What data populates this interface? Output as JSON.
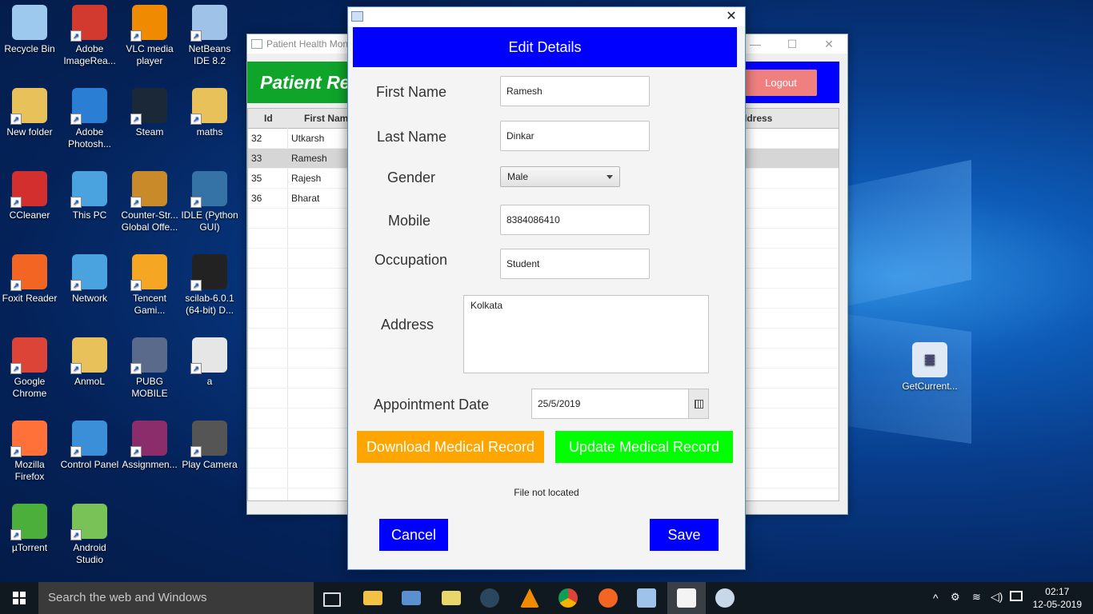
{
  "desktop": {
    "icons": [
      {
        "label": "Recycle Bin",
        "icon": "recycle-bin-icon",
        "color": "#9ec9ef"
      },
      {
        "label": "Adobe ImageRea...",
        "icon": "adobe-imageready-icon",
        "color": "#d33a2f"
      },
      {
        "label": "VLC media player",
        "icon": "vlc-icon",
        "color": "#f08a00"
      },
      {
        "label": "NetBeans IDE 8.2",
        "icon": "netbeans-icon",
        "color": "#9fc3e8"
      },
      {
        "label": "New folder",
        "icon": "folder-icon",
        "color": "#e8c15a"
      },
      {
        "label": "Adobe Photosh...",
        "icon": "adobe-photoshop-icon",
        "color": "#2a7fd4"
      },
      {
        "label": "Steam",
        "icon": "steam-icon",
        "color": "#1b2838"
      },
      {
        "label": "maths",
        "icon": "folder-icon",
        "color": "#e8c15a"
      },
      {
        "label": "CCleaner",
        "icon": "ccleaner-icon",
        "color": "#d32f2f"
      },
      {
        "label": "This PC",
        "icon": "computer-icon",
        "color": "#4aa3df"
      },
      {
        "label": "Counter-Str... Global Offe...",
        "icon": "csgo-icon",
        "color": "#c98b2a"
      },
      {
        "label": "IDLE (Python GUI)",
        "icon": "python-icon",
        "color": "#3572a5"
      },
      {
        "label": "Foxit Reader",
        "icon": "foxit-icon",
        "color": "#f26522"
      },
      {
        "label": "Network",
        "icon": "network-icon",
        "color": "#4aa3df"
      },
      {
        "label": "Tencent Gami...",
        "icon": "tencent-icon",
        "color": "#f5a623"
      },
      {
        "label": "scilab-6.0.1 (64-bit) D...",
        "icon": "scilab-icon",
        "color": "#222222"
      },
      {
        "label": "Google Chrome",
        "icon": "chrome-icon",
        "color": "#db4437"
      },
      {
        "label": "AnmoL",
        "icon": "user-folder-icon",
        "color": "#e8c15a"
      },
      {
        "label": "PUBG MOBILE",
        "icon": "pubg-icon",
        "color": "#5a6a8a"
      },
      {
        "label": "a",
        "icon": "file-gear-icon",
        "color": "#e6e6e6"
      },
      {
        "label": "Mozilla Firefox",
        "icon": "firefox-icon",
        "color": "#ff7139"
      },
      {
        "label": "Control Panel",
        "icon": "control-panel-icon",
        "color": "#3b8fd8"
      },
      {
        "label": "Assignmen...",
        "icon": "winrar-icon",
        "color": "#8b2c6b"
      },
      {
        "label": "Play Camera",
        "icon": "camera-icon",
        "color": "#555555"
      },
      {
        "label": "µTorrent",
        "icon": "utorrent-icon",
        "color": "#4cae3b"
      },
      {
        "label": "Android Studio",
        "icon": "android-studio-icon",
        "color": "#78c257"
      }
    ],
    "right_icon": {
      "label": "GetCurrent...",
      "icon": "notepad-icon"
    }
  },
  "bg_window": {
    "title": "Patient Health Mon",
    "banner": "Patient Re",
    "logout_label": "Logout",
    "columns": [
      "Id",
      "First Nam",
      "ddress"
    ],
    "rows": [
      {
        "id": "32",
        "first": "Utkarsh"
      },
      {
        "id": "33",
        "first": "Ramesh"
      },
      {
        "id": "35",
        "first": "Rajesh"
      },
      {
        "id": "36",
        "first": "Bharat"
      }
    ]
  },
  "dialog": {
    "header": "Edit  Details",
    "close": "✕",
    "fields": {
      "first_name_label": "First Name",
      "first_name_value": "Ramesh",
      "last_name_label": "Last Name",
      "last_name_value": "Dinkar",
      "gender_label": "Gender",
      "gender_value": "Male",
      "mobile_label": "Mobile",
      "mobile_value": "8384086410",
      "occupation_label": "Occupation",
      "occupation_value": "Student",
      "address_label": "Address",
      "address_value": "Kolkata",
      "date_label": "Appointment Date",
      "date_value": "25/5/2019"
    },
    "download_label": "Download Medical Record",
    "update_label": "Update Medical Record",
    "status": "File not located",
    "cancel_label": "Cancel",
    "save_label": "Save"
  },
  "taskbar": {
    "search_placeholder": "Search the web and Windows",
    "time": "02:17",
    "date": "12-05-2019"
  },
  "colors": {
    "header_blue": "#0000ff",
    "download_orange": "#ffa500",
    "update_green": "#00ff00",
    "logout_salmon": "#f08080",
    "banner_green": "#0ea52a"
  }
}
